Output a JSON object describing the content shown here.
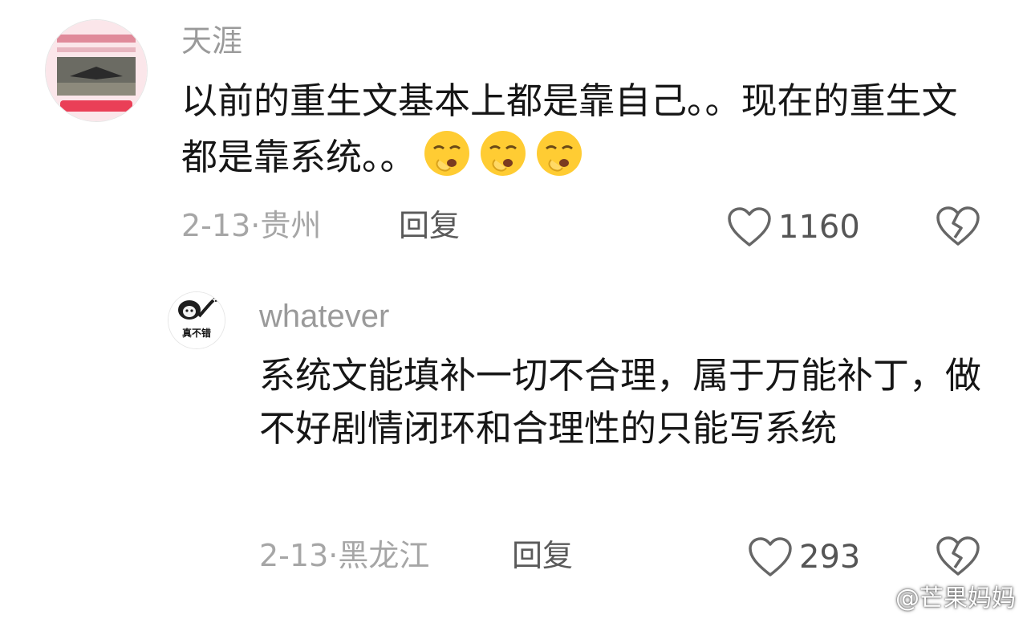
{
  "comments": [
    {
      "username": "天涯",
      "text": "以前的重生文基本上都是靠自己。。现在的重生文都是靠系统。。",
      "emoji_icons": [
        "yawning-face-icon",
        "yawning-face-icon",
        "yawning-face-icon"
      ],
      "date": "2-13",
      "separator": "·",
      "location": "贵州",
      "reply_label": "回复",
      "likes": "1160"
    },
    {
      "username": "whatever",
      "avatar_caption": "真不错",
      "text": "系统文能填补一切不合理，属于万能补丁，做不好剧情闭环和合理性的只能写系统",
      "date": "2-13",
      "separator": "·",
      "location": "黑龙江",
      "reply_label": "回复",
      "likes": "293"
    }
  ],
  "icons": {
    "like": "heart-outline-icon",
    "dislike": "broken-heart-icon",
    "watermark": "weibo-logo-icon"
  },
  "watermark": {
    "text": "@芒果妈妈"
  },
  "colors": {
    "text": "#161616",
    "muted": "#a6a6a6",
    "username": "#9a9a9a",
    "emoji": "#ffcc33"
  }
}
